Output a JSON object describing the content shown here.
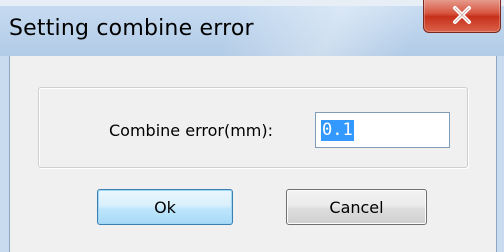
{
  "window": {
    "title": "Setting combine error",
    "close_glyph": "X"
  },
  "form": {
    "combine_label": "Combine error(mm):",
    "combine_value": "0.1"
  },
  "buttons": {
    "ok_label": "Ok",
    "cancel_label": "Cancel"
  },
  "icons": {
    "close": "close-icon"
  },
  "colors": {
    "titlebar": "#bcd3ec",
    "close_button": "#c7301b",
    "dialog_body": "#f0f0f0",
    "selection": "#3399ff",
    "default_button_border": "#3c7fb1"
  }
}
